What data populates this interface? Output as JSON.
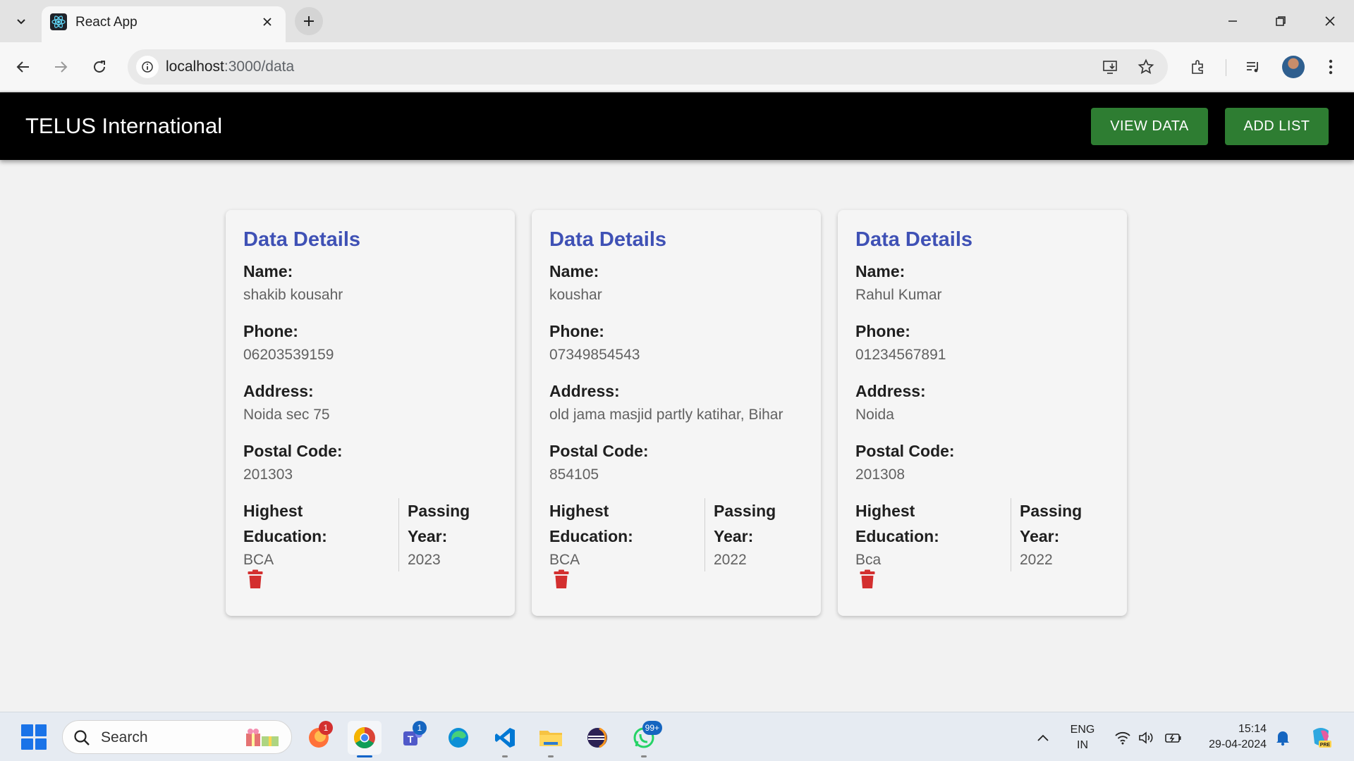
{
  "browser": {
    "tab_title": "React App",
    "url_host": "localhost",
    "url_path": ":3000/data"
  },
  "header": {
    "brand": "TELUS International",
    "view_data_label": "VIEW DATA",
    "add_list_label": "ADD LIST"
  },
  "labels": {
    "card_title": "Data Details",
    "name": "Name:",
    "phone": "Phone:",
    "address": "Address:",
    "postal_code": "Postal Code:",
    "highest": "Highest",
    "education": "Education:",
    "passing": "Passing",
    "year": "Year:"
  },
  "cards": [
    {
      "name": "shakib kousahr",
      "phone": "06203539159",
      "address": "Noida sec 75",
      "postal_code": "201303",
      "education": "BCA",
      "passing_year": "2023"
    },
    {
      "name": "koushar",
      "phone": "07349854543",
      "address": "old jama masjid partly katihar, Bihar",
      "postal_code": "854105",
      "education": "BCA",
      "passing_year": "2022"
    },
    {
      "name": "Rahul Kumar",
      "phone": "01234567891",
      "address": "Noida",
      "postal_code": "201308",
      "education": "Bca",
      "passing_year": "2022"
    }
  ],
  "taskbar": {
    "search_placeholder": "Search",
    "badges": {
      "firefox": "1",
      "teams": "1",
      "whatsapp": "99+"
    },
    "lang_line1": "ENG",
    "lang_line2": "IN",
    "time": "15:14",
    "date": "29-04-2024"
  },
  "colors": {
    "header_bg": "#000000",
    "button_green": "#2e7d32",
    "card_title": "#3f51b5",
    "delete_red": "#d32f2f"
  }
}
